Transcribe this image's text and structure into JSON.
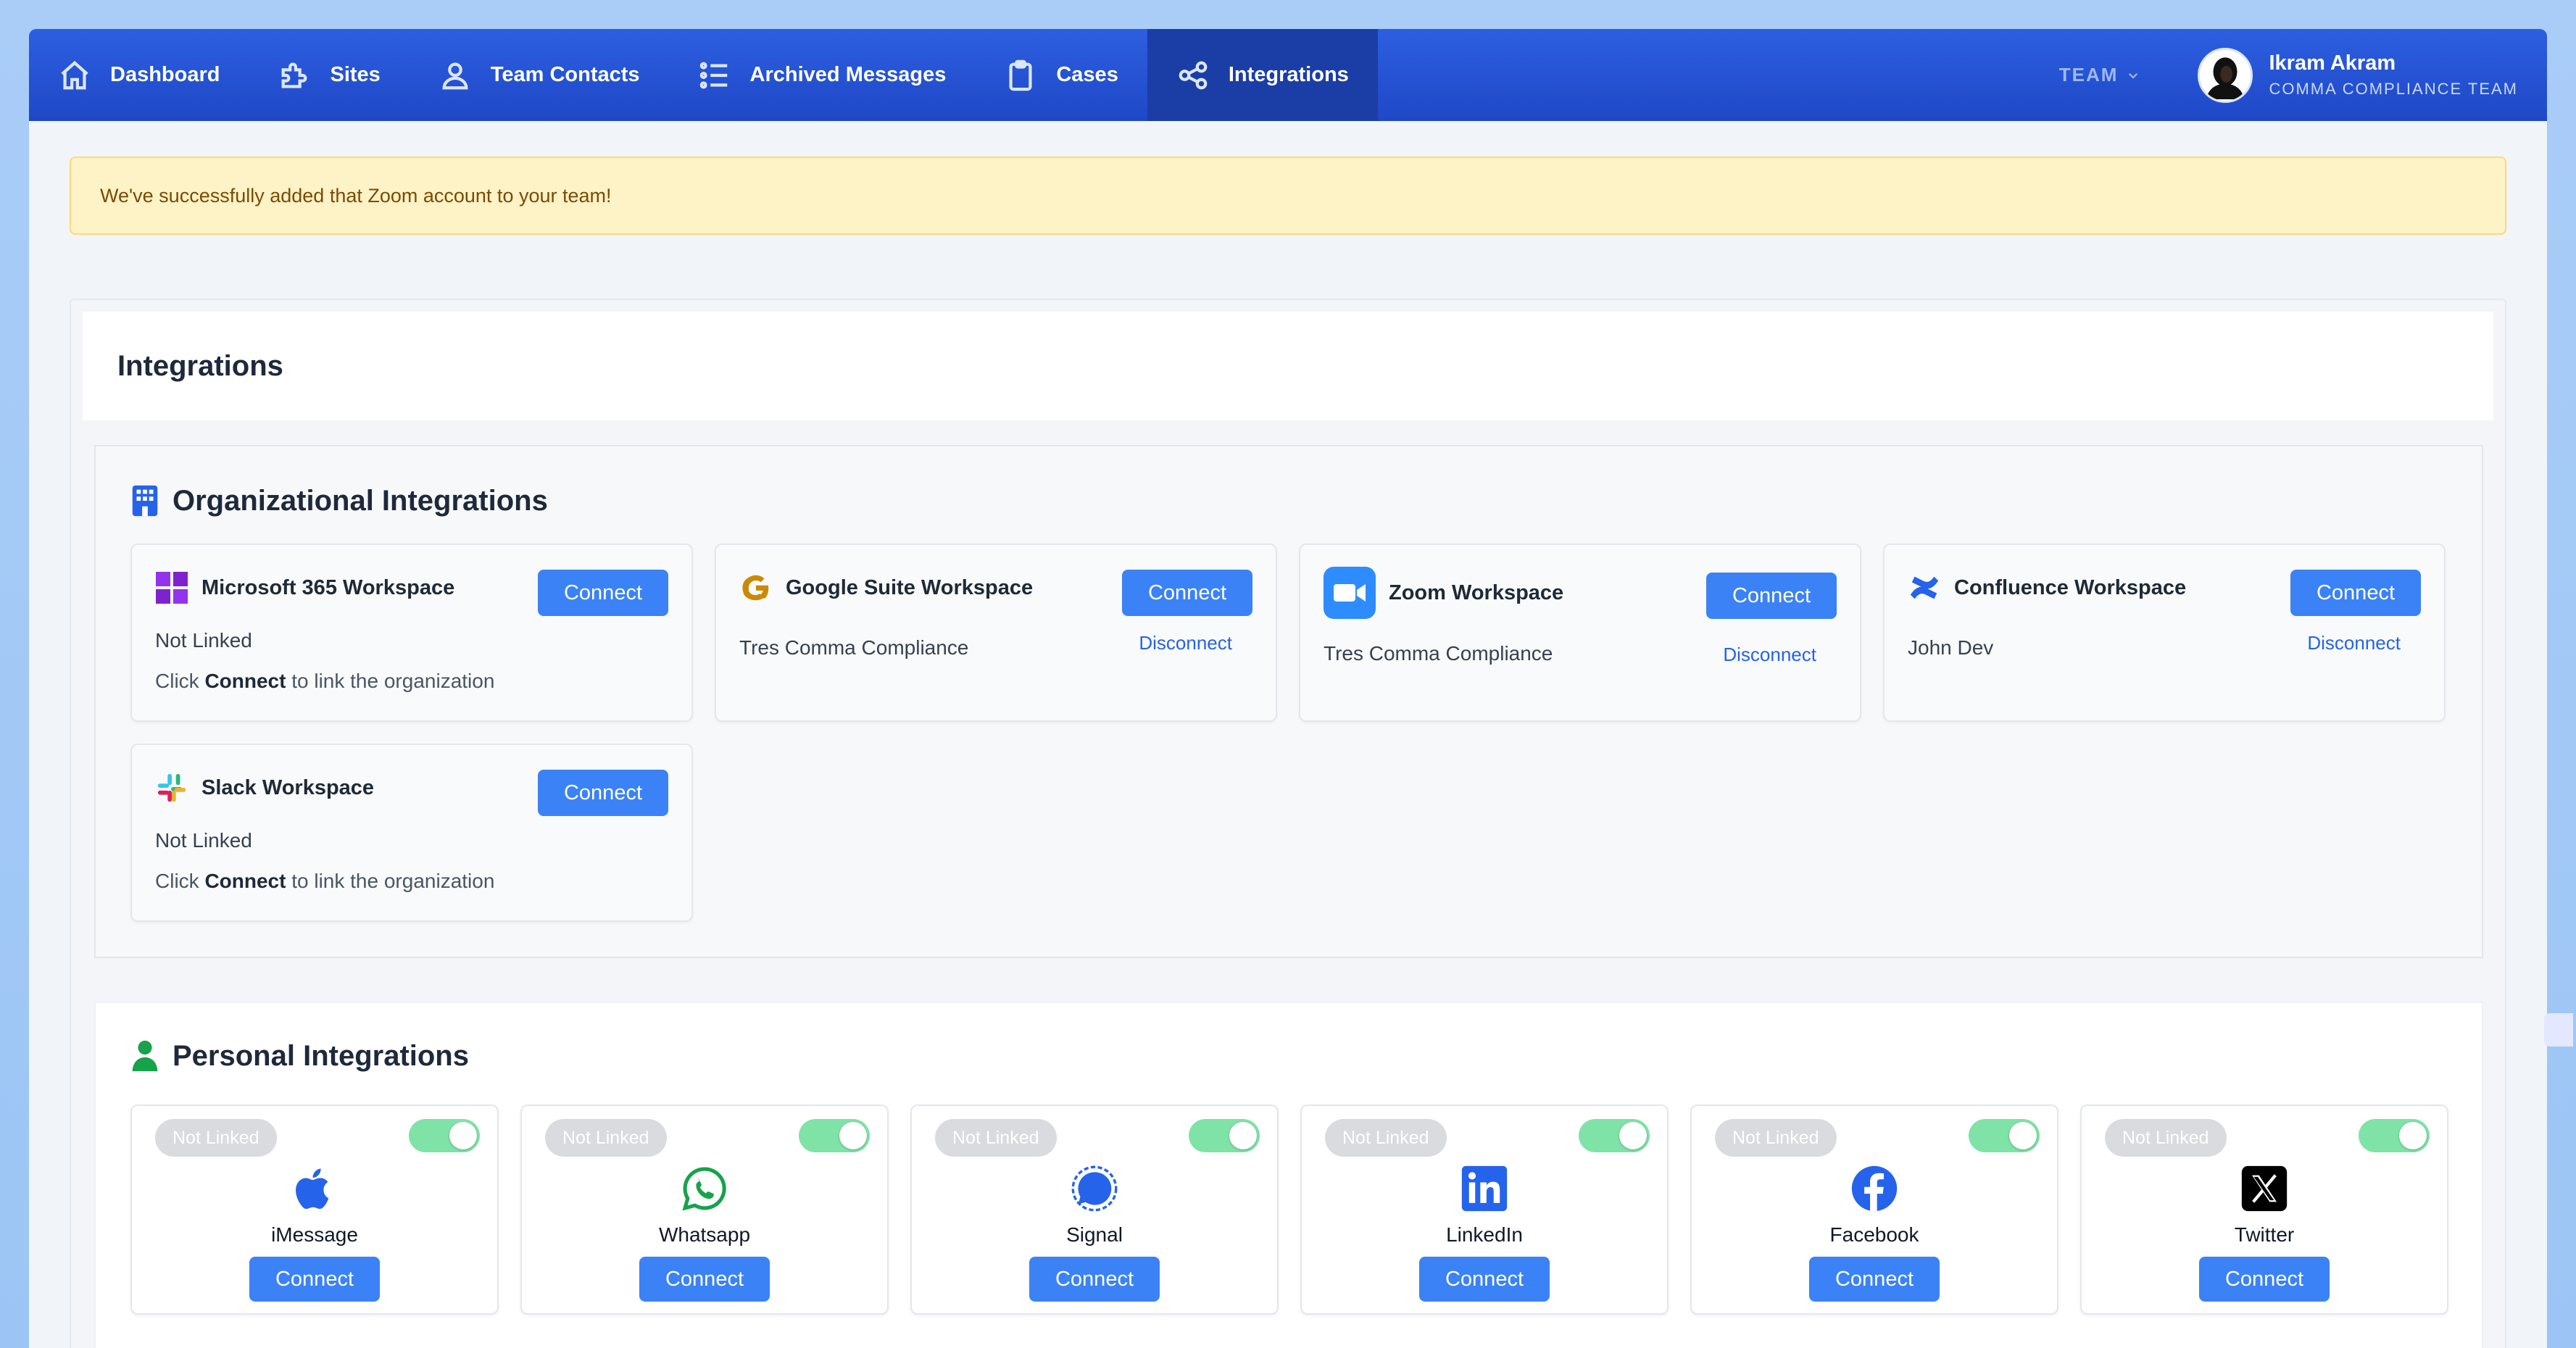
{
  "nav": {
    "items": [
      {
        "label": "Dashboard",
        "icon": "home-icon"
      },
      {
        "label": "Sites",
        "icon": "puzzle-icon"
      },
      {
        "label": "Team Contacts",
        "icon": "user-icon"
      },
      {
        "label": "Archived Messages",
        "icon": "list-icon"
      },
      {
        "label": "Cases",
        "icon": "clipboard-icon"
      },
      {
        "label": "Integrations",
        "icon": "share-icon",
        "active": true
      }
    ],
    "team_dropdown": "TEAM",
    "user": {
      "name": "Ikram Akram",
      "team": "COMMA COMPLIANCE TEAM"
    }
  },
  "alert": {
    "message": "We've successfully added that Zoom account to your team!",
    "color": "#fef3c7"
  },
  "page": {
    "title": "Integrations"
  },
  "org": {
    "title": "Organizational Integrations",
    "connect_label": "Connect",
    "disconnect_label": "Disconnect",
    "hint_pre": "Click ",
    "hint_bold": "Connect",
    "hint_post": " to link the organization",
    "cards": [
      {
        "name": "Microsoft 365 Workspace",
        "status": "Not Linked",
        "linked": false
      },
      {
        "name": "Google Suite Workspace",
        "status": "Tres Comma Compliance",
        "linked": true
      },
      {
        "name": "Zoom Workspace",
        "status": "Tres Comma Compliance",
        "linked": true
      },
      {
        "name": "Confluence Workspace",
        "status": "John Dev",
        "linked": true
      },
      {
        "name": "Slack Workspace",
        "status": "Not Linked",
        "linked": false
      }
    ]
  },
  "personal": {
    "title": "Personal Integrations",
    "badge": "Not Linked",
    "connect_label": "Connect",
    "cards": [
      {
        "name": "iMessage",
        "icon": "apple-icon"
      },
      {
        "name": "Whatsapp",
        "icon": "whatsapp-icon"
      },
      {
        "name": "Signal",
        "icon": "signal-icon"
      },
      {
        "name": "LinkedIn",
        "icon": "linkedin-icon"
      },
      {
        "name": "Facebook",
        "icon": "facebook-icon"
      },
      {
        "name": "Twitter",
        "icon": "x-icon"
      }
    ]
  },
  "colors": {
    "primary": "#3b82f6",
    "nav": "#1f48c7",
    "toggle_on": "#7fe3a7"
  }
}
